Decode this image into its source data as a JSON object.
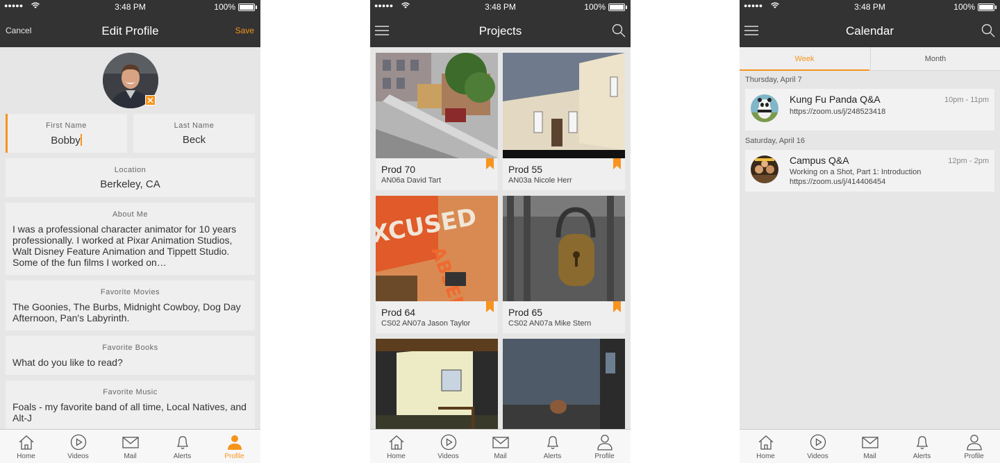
{
  "status_bar": {
    "time": "3:48 PM",
    "battery": "100%"
  },
  "tabs": [
    "Home",
    "Videos",
    "Mail",
    "Alerts",
    "Profile"
  ],
  "accent_color": "#f7941d",
  "edit_profile": {
    "title": "Edit Profile",
    "cancel": "Cancel",
    "save": "Save",
    "first_name_label": "First Name",
    "first_name": "Bobby",
    "last_name_label": "Last Name",
    "last_name": "Beck",
    "location_label": "Location",
    "location": "Berkeley, CA",
    "about_label": "About Me",
    "about": "I was a professional character animator for 10 years professionally. I worked at Pixar Animation Studios, Walt Disney Feature Animation and Tippett Studio. Some of the fun films I worked on…",
    "movies_label": "Favorite Movies",
    "movies": "The Goonies, The Burbs, Midnight Cowboy, Dog Day Afternoon, Pan's Labyrinth.",
    "books_label": "Favorite Books",
    "books": "What do you like to read?",
    "music_label": "Favorite Music",
    "music": "Foals - my favorite band of all time, Local Natives, and Alt-J"
  },
  "projects": {
    "title": "Projects",
    "items": [
      {
        "name": "Prod 70",
        "sub": "AN06a David Tart"
      },
      {
        "name": "Prod 55",
        "sub": "AN03a Nicole Herr"
      },
      {
        "name": "Prod 64",
        "sub": "CS02 AN07a Jason Taylor"
      },
      {
        "name": "Prod 65",
        "sub": "CS02 AN07a Mike Stern"
      }
    ]
  },
  "calendar": {
    "title": "Calendar",
    "week": "Week",
    "month": "Month",
    "days": [
      {
        "label": "Thursday, April 7",
        "events": [
          {
            "title": "Kung Fu Panda Q&A",
            "time": "10pm - 11pm",
            "lines": [
              "https://zoom.us/j/248523418"
            ]
          }
        ]
      },
      {
        "label": "Saturday, April 16",
        "events": [
          {
            "title": "Campus Q&A",
            "time": "12pm - 2pm",
            "lines": [
              "Working on a Shot, Part 1: Introduction",
              "https://zoom.us/j/414406454"
            ]
          }
        ]
      }
    ]
  }
}
